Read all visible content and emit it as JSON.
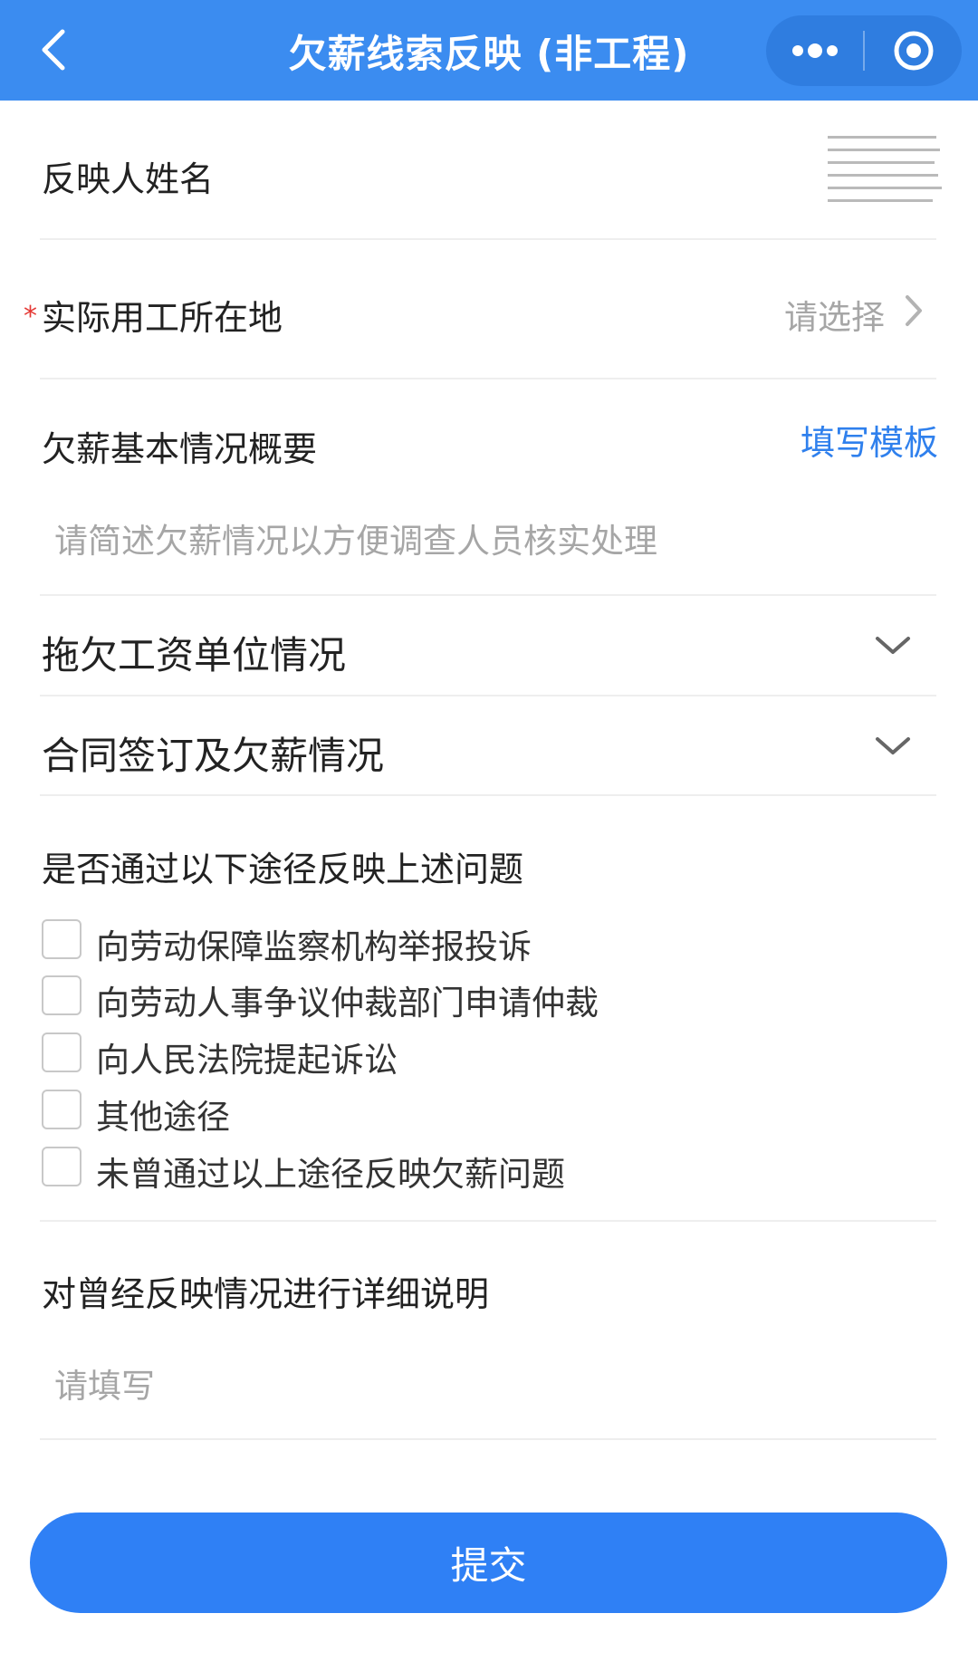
{
  "navbar": {
    "title": "欠薪线索反映 (非工程)",
    "icons": {
      "back": "chevron-left-icon",
      "more": "more-dots-icon",
      "close": "target-close-icon"
    }
  },
  "form": {
    "reporter_name_label": "反映人姓名",
    "location": {
      "required_mark": "*",
      "label": "实际用工所在地",
      "placeholder": "请选择"
    },
    "summary": {
      "label": "欠薪基本情况概要",
      "template_link": "填写模板",
      "placeholder": "请简述欠薪情况以方便调查人员核实处理"
    },
    "sections": [
      {
        "label": "拖欠工资单位情况"
      },
      {
        "label": "合同签订及欠薪情况"
      }
    ],
    "channels": {
      "label": "是否通过以下途径反映上述问题",
      "options": [
        "向劳动保障监察机构举报投诉",
        "向劳动人事争议仲裁部门申请仲裁",
        "向人民法院提起诉讼",
        "其他途径",
        "未曾通过以上途径反映欠薪问题"
      ]
    },
    "detail": {
      "label": "对曾经反映情况进行详细说明",
      "placeholder": "请填写"
    }
  },
  "submit_label": "提交",
  "colors": {
    "primary": "#3b8cf0",
    "button": "#2f80f5",
    "link": "#2f80ed",
    "required": "#e53935"
  }
}
